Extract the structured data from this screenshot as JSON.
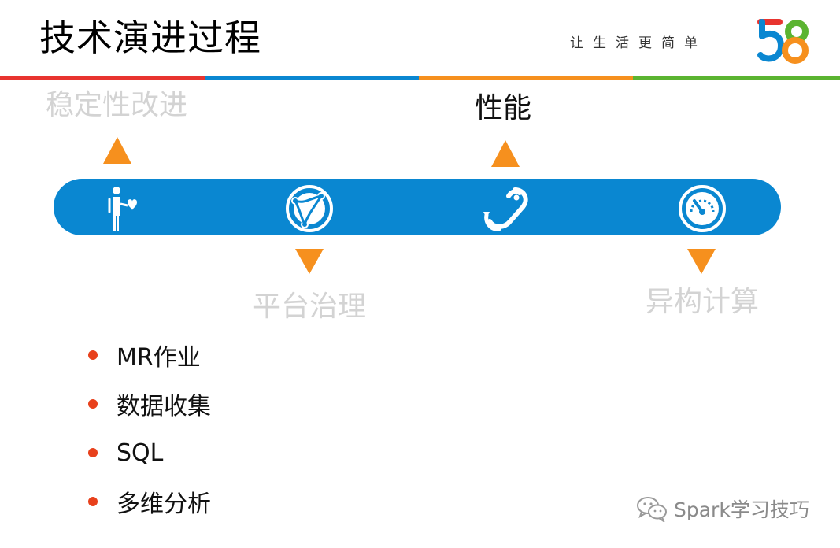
{
  "slide": {
    "title": "技术演进过程",
    "slogan": "让生活更简单",
    "logo_text": "58"
  },
  "colors": {
    "stripes": [
      "#e8342f",
      "#0a87d1",
      "#f6901e",
      "#5bb431"
    ],
    "band": "#0a87d1",
    "arrow": "#f6901e",
    "bullet": "#e8411c",
    "inactive_label": "#d3d3d3"
  },
  "timeline": {
    "stages": [
      {
        "label": "稳定性改进",
        "icon": "person-heart-icon",
        "active": false
      },
      {
        "label": "平台治理",
        "icon": "globe-network-icon",
        "active": false
      },
      {
        "label": "性能",
        "icon": "link-refresh-icon",
        "active": true
      },
      {
        "label": "异构计算",
        "icon": "speedometer-icon",
        "active": false
      }
    ]
  },
  "bullets": [
    "MR作业",
    "数据收集",
    "SQL",
    "多维分析"
  ],
  "watermark": {
    "icon": "wechat-icon",
    "text": "Spark学习技巧"
  }
}
